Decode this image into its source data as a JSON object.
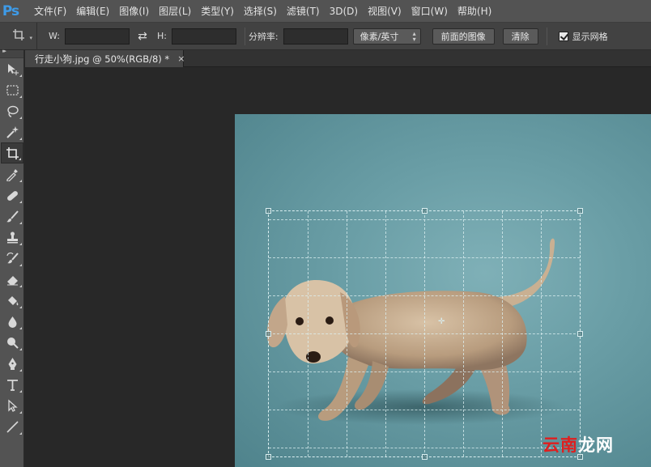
{
  "app": {
    "logo": "Ps"
  },
  "menu": [
    {
      "label": "文件(F)"
    },
    {
      "label": "编辑(E)"
    },
    {
      "label": "图像(I)"
    },
    {
      "label": "图层(L)"
    },
    {
      "label": "类型(Y)"
    },
    {
      "label": "选择(S)"
    },
    {
      "label": "滤镜(T)"
    },
    {
      "label": "3D(D)"
    },
    {
      "label": "视图(V)"
    },
    {
      "label": "窗口(W)"
    },
    {
      "label": "帮助(H)"
    }
  ],
  "options": {
    "width_label": "W:",
    "width_value": "",
    "height_label": "H:",
    "height_value": "",
    "resolution_label": "分辨率:",
    "resolution_value": "",
    "unit_select": "像素/英寸",
    "front_image_button": "前面的图像",
    "clear_button": "清除",
    "show_grid_label": "显示网格",
    "show_grid_checked": true
  },
  "document": {
    "tab_title": "行走小狗.jpg @ 50%(RGB/8) *",
    "close_glyph": "×"
  },
  "tools": [
    {
      "name": "move-tool"
    },
    {
      "name": "marquee-tool"
    },
    {
      "name": "lasso-tool"
    },
    {
      "name": "magic-wand-tool"
    },
    {
      "name": "crop-tool",
      "active": true
    },
    {
      "name": "eyedropper-tool"
    },
    {
      "name": "healing-brush-tool"
    },
    {
      "name": "brush-tool"
    },
    {
      "name": "clone-stamp-tool"
    },
    {
      "name": "history-brush-tool"
    },
    {
      "name": "eraser-tool"
    },
    {
      "name": "paint-bucket-tool"
    },
    {
      "name": "blur-tool"
    },
    {
      "name": "dodge-tool"
    },
    {
      "name": "pen-tool"
    },
    {
      "name": "type-tool"
    },
    {
      "name": "path-selection-tool"
    },
    {
      "name": "line-tool"
    }
  ],
  "watermark": {
    "part1": "云南",
    "part2": "龙网"
  },
  "colors": {
    "ps_blue": "#3e9be8",
    "canvas_bg": "#282828",
    "photo_bg": "#6a9ea6",
    "watermark_red": "#e01e1e"
  }
}
